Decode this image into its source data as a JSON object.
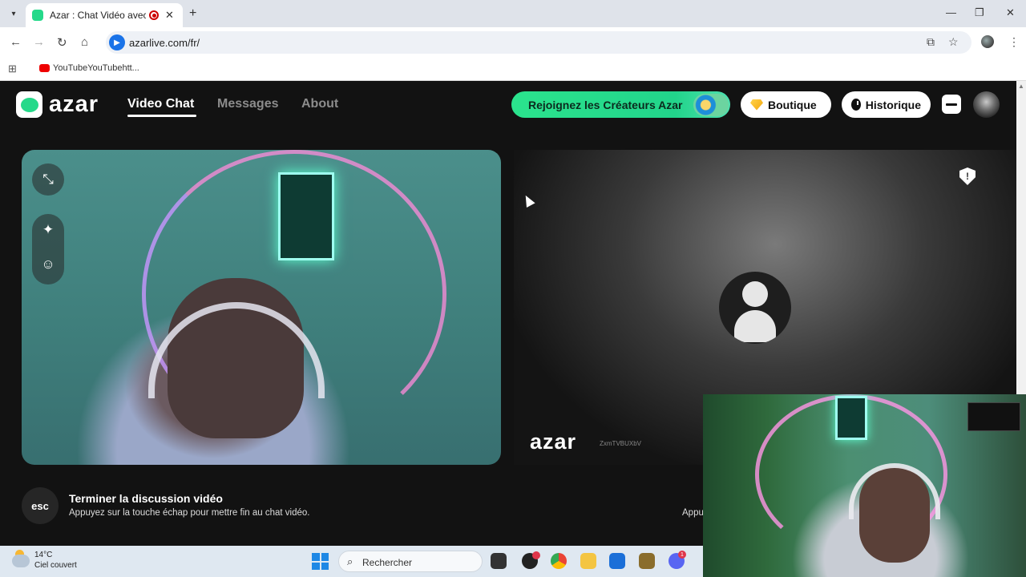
{
  "browser": {
    "tab_title": "Azar : Chat Vidéo avec de n",
    "url": "azarlive.com/fr/",
    "bookmark_label": "YouTubeYouTubehtt..."
  },
  "site": {
    "logo": "azar",
    "nav": [
      {
        "label": "Video Chat",
        "active": true
      },
      {
        "label": "Messages",
        "active": false
      },
      {
        "label": "About",
        "active": false
      }
    ],
    "creators_label": "Rejoignez les Créateurs Azar",
    "shop_label": "Boutique",
    "history_label": "Historique",
    "remote_logo": "azar",
    "remote_id": "ZxmTVBUXbV",
    "hint_key": "esc",
    "hint_title": "Terminer la discussion vidéo",
    "hint_subtitle": "Appuyez sur la touche échap pour mettre fin au chat vidéo.",
    "hint_right": "Appu"
  },
  "taskbar": {
    "temperature": "14°C",
    "condition": "Ciel couvert",
    "search_placeholder": "Rechercher",
    "discord_badge": "1"
  },
  "colors": {
    "brand_green": "#25d98a",
    "background": "#121212"
  }
}
